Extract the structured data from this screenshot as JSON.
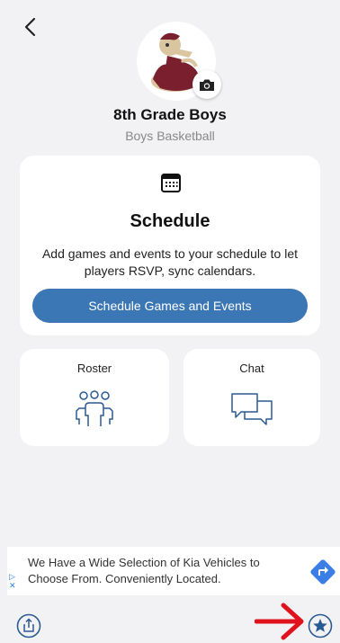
{
  "team": {
    "name": "8th Grade Boys",
    "sport": "Boys Basketball"
  },
  "schedule_card": {
    "title": "Schedule",
    "description": "Add games and events to your schedule to let players RSVP, sync calendars.",
    "button_label": "Schedule Games and Events"
  },
  "tiles": {
    "roster_label": "Roster",
    "chat_label": "Chat"
  },
  "ad": {
    "text": "We Have a Wide Selection of Kia Vehicles to Choose From. Conveniently Located."
  },
  "colors": {
    "accent": "#3b76b5",
    "icon_blue": "#2a5a93",
    "annotation_red": "#e0121c",
    "background": "#f2f2f4",
    "mascot_maroon": "#7a1f2e"
  },
  "icons": [
    "chevron-left-icon",
    "camera-icon",
    "calendar-icon",
    "group-icon",
    "chat-bubbles-icon",
    "ad-choices-icon",
    "directions-icon",
    "share-icon",
    "star-icon",
    "red-arrow-icon"
  ]
}
